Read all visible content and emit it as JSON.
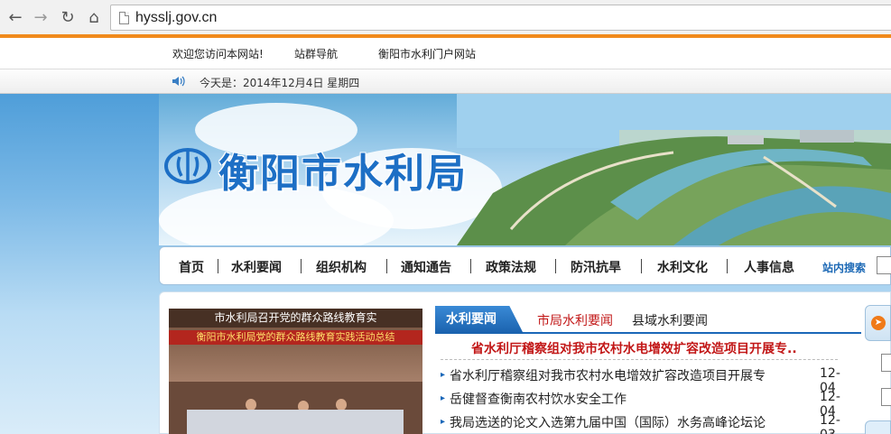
{
  "browser": {
    "url": "hysslj.gov.cn"
  },
  "topbar": {
    "welcome": "欢迎您访问本网站!",
    "site_nav": "站群导航",
    "portal": "衡阳市水利门户网站"
  },
  "datebar": {
    "date_text": "今天是：2014年12月4日 星期四"
  },
  "banner": {
    "title": "衡阳市水利局"
  },
  "nav": {
    "items": [
      "首页",
      "水利要闻",
      "组织机构",
      "通知通告",
      "政策法规",
      "防汛抗旱",
      "水利文化",
      "人事信息"
    ],
    "search_label": "站内搜索"
  },
  "photo": {
    "caption": "市水利局召开党的群众路线教育实",
    "banner_text": "衡阳市水利局党的群众路线教育实践活动总结"
  },
  "news": {
    "active_tab": "水利要闻",
    "tabs": [
      "市局水利要闻",
      "县域水利要闻"
    ],
    "headline": "省水利厅稽察组对我市农村水电增效扩容改造项目开展专..",
    "rows": [
      {
        "title": "省水利厅稽察组对我市农村水电增效扩容改造项目开展专",
        "date": "12-04"
      },
      {
        "title": "岳健督查衡南农村饮水安全工作",
        "date": "12-04"
      },
      {
        "title": "我局选送的论文入选第九届中国（国际）水务高峰论坛论",
        "date": "12-03"
      }
    ]
  },
  "colors": {
    "accent_orange": "#f08a1c",
    "brand_blue": "#1d6fc5",
    "headline_red": "#c21717",
    "active_tab_red": "#c21717"
  }
}
